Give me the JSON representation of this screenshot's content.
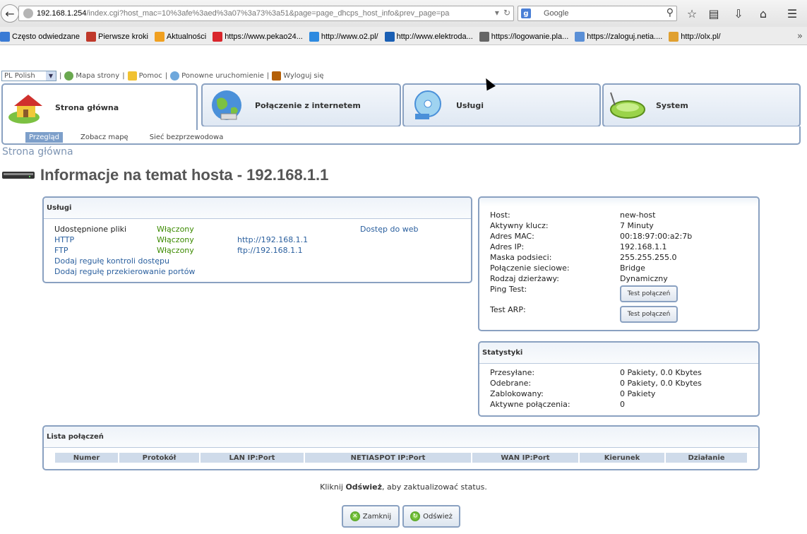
{
  "browser": {
    "url_host": "192.168.1.254",
    "url_rest": "/index.cgi?host_mac=10%3afe%3aed%3a07%3a73%3a51&page=page_dhcps_host_info&prev_page=page_dhcps",
    "search_placeholder": "Google",
    "bookmarks": [
      {
        "label": "Często odwiedzane",
        "color": "#3a7bd5"
      },
      {
        "label": "Pierwsze kroki",
        "color": "#c0392b"
      },
      {
        "label": "Aktualności",
        "color": "#f0a020"
      },
      {
        "label": "https://www.pekao24...",
        "color": "#d9262c"
      },
      {
        "label": "http://www.o2.pl/",
        "color": "#2d8ae0"
      },
      {
        "label": "http://www.elektroda...",
        "color": "#1a5fb4"
      },
      {
        "label": "https://logowanie.pla...",
        "color": "#666666"
      },
      {
        "label": "https://zaloguj.netia....",
        "color": "#5a8fd6"
      },
      {
        "label": "http://olx.pl/",
        "color": "#e0a030"
      }
    ]
  },
  "topbar": {
    "language": "PL Polish",
    "sitemap": "Mapa strony",
    "help": "Pomoc",
    "restart": "Ponowne uruchomienie",
    "logout": "Wyloguj się"
  },
  "tabs": [
    {
      "label": "Strona główna"
    },
    {
      "label": "Połączenie z internetem"
    },
    {
      "label": "Usługi"
    },
    {
      "label": "System"
    }
  ],
  "subnav": [
    "Przegląd",
    "Zobacz mapę",
    "Sieć bezprzewodowa"
  ],
  "breadcrumb": "Strona główna",
  "title": "Informacje na temat hosta - 192.168.1.1",
  "services": {
    "heading": "Usługi",
    "shared_files": "Udostępnione pliki",
    "shared_status": "Włączony",
    "web_access": "Dostęp do web",
    "http": "HTTP",
    "http_status": "Włączony",
    "http_link": "http://192.168.1.1",
    "ftp": "FTP",
    "ftp_status": "Włączony",
    "ftp_link": "ftp://192.168.1.1",
    "add_access_rule": "Dodaj regułę kontroli dostępu",
    "add_port_rule": "Dodaj regułę przekierowanie portów"
  },
  "host_info": {
    "host_label": "Host:",
    "host": "new-host",
    "lease_label": "Aktywny klucz:",
    "lease": "7 Minuty",
    "mac_label": "Adres MAC:",
    "mac": "00:18:97:00:a2:7b",
    "ip_label": "Adres IP:",
    "ip": "192.168.1.1",
    "mask_label": "Maska podsieci:",
    "mask": "255.255.255.0",
    "conn_label": "Połączenie sieciowe:",
    "conn": "Bridge",
    "lease_type_label": "Rodzaj dzierżawy:",
    "lease_type": "Dynamiczny",
    "ping_label": "Ping Test:",
    "ping_button": "Test połączeń",
    "arp_label": "Test ARP:",
    "arp_button": "Test połączeń"
  },
  "stats": {
    "heading": "Statystyki",
    "sent_label": "Przesyłane:",
    "sent": "0 Pakiety, 0.0 Kbytes",
    "recv_label": "Odebrane:",
    "recv": "0 Pakiety, 0.0 Kbytes",
    "blocked_label": "Zablokowany:",
    "blocked": "0 Pakiety",
    "active_label": "Aktywne połączenia:",
    "active": "0"
  },
  "connections": {
    "heading": "Lista połączeń",
    "columns": [
      "Numer",
      "Protokół",
      "LAN IP:Port",
      "NETIASPOT IP:Port",
      "WAN IP:Port",
      "Kierunek",
      "Działanie"
    ]
  },
  "footer": {
    "status_pre": "Kliknij ",
    "status_bold": "Odśwież",
    "status_post": ", aby zaktualizować status.",
    "close_button": "Zamknij",
    "refresh_button": "Odśwież"
  }
}
